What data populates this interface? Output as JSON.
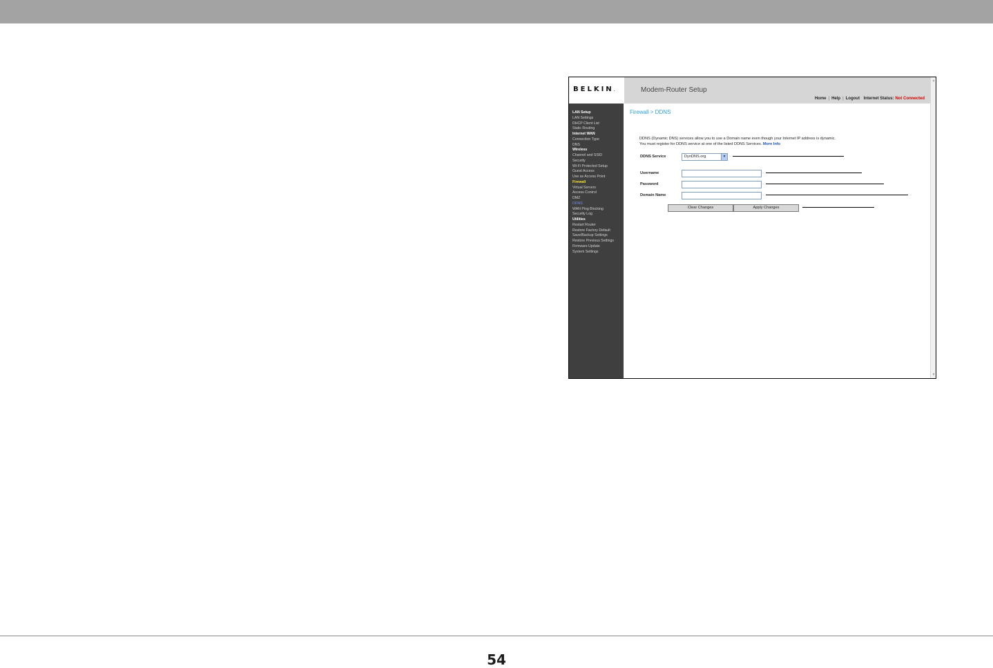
{
  "page": {
    "page_number": "54"
  },
  "header": {
    "logo": "BELKIN",
    "logo_mark": ".",
    "title": "Modem-Router Setup",
    "links": {
      "home": "Home",
      "help": "Help",
      "logout": "Logout"
    },
    "status_label": "Internet Status:",
    "status_value": "Not Connected"
  },
  "sidebar": {
    "items": [
      {
        "label": "LAN Setup",
        "kind": "head"
      },
      {
        "label": "LAN Settings",
        "kind": "item"
      },
      {
        "label": "DHCP Client List",
        "kind": "item"
      },
      {
        "label": "Static Routing",
        "kind": "item"
      },
      {
        "label": "Internet WAN",
        "kind": "head"
      },
      {
        "label": "Connection Type",
        "kind": "item"
      },
      {
        "label": "DNS",
        "kind": "item"
      },
      {
        "label": "Wireless",
        "kind": "head"
      },
      {
        "label": "Channel and SSID",
        "kind": "item"
      },
      {
        "label": "Security",
        "kind": "item"
      },
      {
        "label": "Wi-Fi Protected Setup",
        "kind": "item"
      },
      {
        "label": "Guest Access",
        "kind": "item"
      },
      {
        "label": "Use as Access Point",
        "kind": "item"
      },
      {
        "label": "Firewall",
        "kind": "head-active"
      },
      {
        "label": "Virtual Servers",
        "kind": "item"
      },
      {
        "label": "Access Control",
        "kind": "item"
      },
      {
        "label": "DMZ",
        "kind": "item"
      },
      {
        "label": "DDNS",
        "kind": "current"
      },
      {
        "label": "WAN Ping Blocking",
        "kind": "item"
      },
      {
        "label": "Security Log",
        "kind": "item"
      },
      {
        "label": "Utilities",
        "kind": "head"
      },
      {
        "label": "Restart Router",
        "kind": "item"
      },
      {
        "label": "Restore Factory Default",
        "kind": "item"
      },
      {
        "label": "Save/Backup Settings",
        "kind": "item"
      },
      {
        "label": "Restore Previous Settings",
        "kind": "item"
      },
      {
        "label": "Firmware Update",
        "kind": "item"
      },
      {
        "label": "System Settings",
        "kind": "item"
      }
    ]
  },
  "content": {
    "breadcrumb": "Firewall > DDNS",
    "desc_line1": "DDNS (Dynamic DNS) services allow you to use a Domain name even though your Internet IP address is dynamic.",
    "desc_line2": "You must register for DDNS service at one of the listed DDNS Services.",
    "more_info": "More Info",
    "ddns_service_label": "DDNS Service",
    "ddns_service_value": "DynDNS.org",
    "username_label": "Username",
    "username_value": "",
    "password_label": "Password",
    "password_value": "",
    "domain_label": "Domain Name",
    "domain_value": "",
    "clear_button": "Clear Changes",
    "apply_button": "Apply Changes"
  },
  "colors": {
    "breadcrumb": "#2f9fd6",
    "status_alert": "#d10000",
    "sidebar_bg": "#3f3f3f",
    "sidebar_active": "#f2e233"
  },
  "icons": {
    "select_arrow": "chevron-down-icon"
  }
}
